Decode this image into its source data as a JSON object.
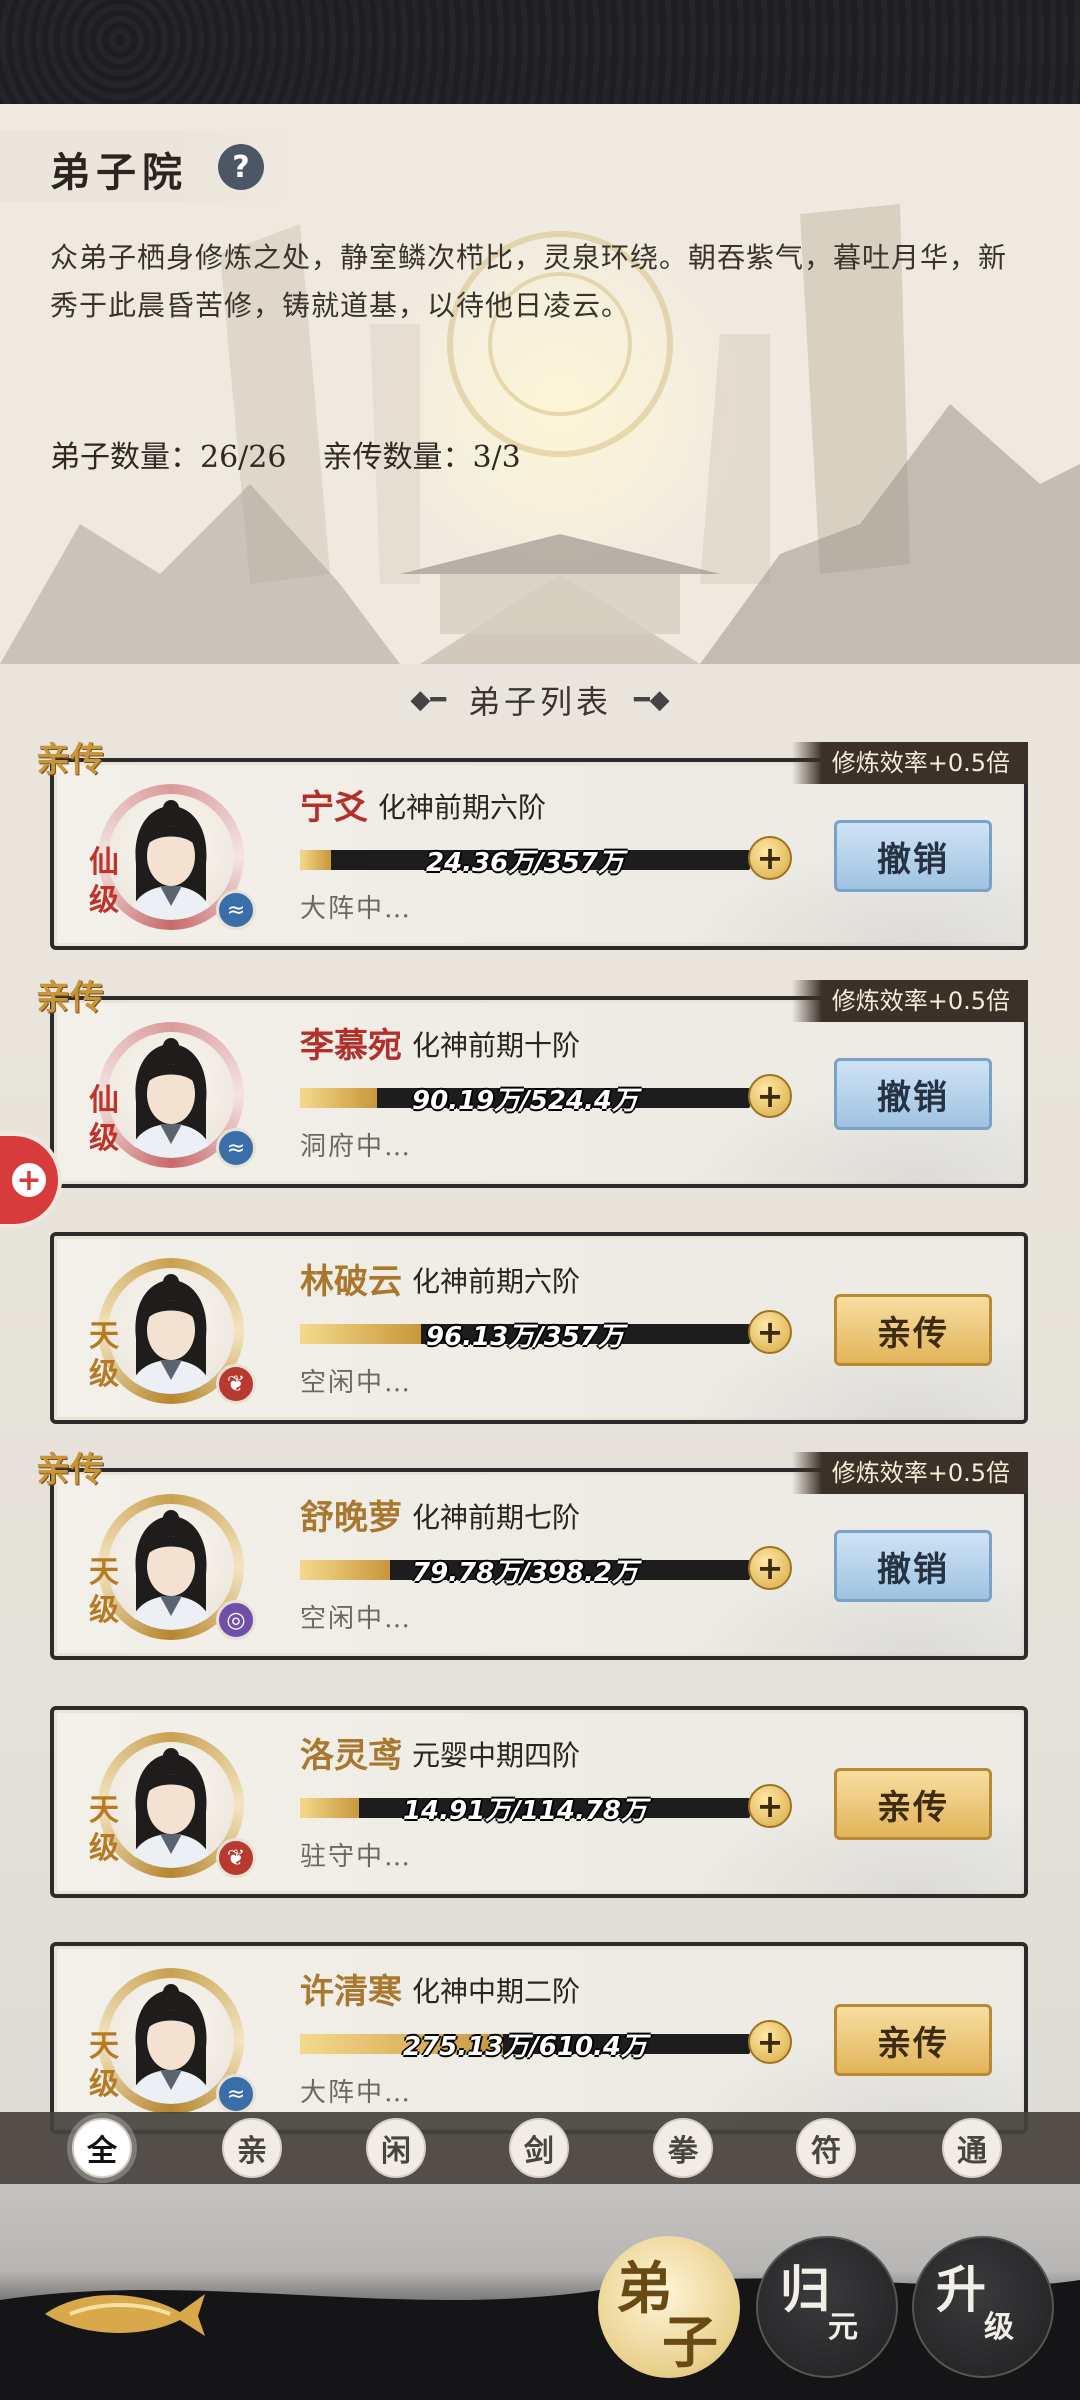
{
  "header": {
    "title": "弟子院",
    "help_icon": "?",
    "description": "众弟子栖身修炼之处，静室鳞次栉比，灵泉环绕。朝吞紫气，暮吐月华，新秀于此晨昏苦修，铸就道基，以待他日凌云。",
    "disciple_count": "弟子数量：26/26",
    "inner_count": "亲传数量：3/3"
  },
  "list_title": "弟子列表",
  "disciples": [
    {
      "tag": "亲传",
      "rate": "修炼效率+0.5倍",
      "grade": "仙级",
      "name": "宁爻",
      "realm": "化神前期六阶",
      "progress_text": "24.36万/357万",
      "progress": 0.068,
      "status": "大阵中…",
      "action": "撤销",
      "element_icon": "water-icon"
    },
    {
      "tag": "亲传",
      "rate": "修炼效率+0.5倍",
      "grade": "仙级",
      "name": "李慕宛",
      "realm": "化神前期十阶",
      "progress_text": "90.19万/524.4万",
      "progress": 0.172,
      "status": "洞府中…",
      "action": "撤销",
      "element_icon": "water-icon"
    },
    {
      "tag": "",
      "rate": "",
      "grade": "天级",
      "name": "林破云",
      "realm": "化神前期六阶",
      "progress_text": "96.13万/357万",
      "progress": 0.269,
      "status": "空闲中…",
      "action": "亲传",
      "element_icon": "fire-icon"
    },
    {
      "tag": "亲传",
      "rate": "修炼效率+0.5倍",
      "grade": "天级",
      "name": "舒晚萝",
      "realm": "化神前期七阶",
      "progress_text": "79.78万/398.2万",
      "progress": 0.2,
      "status": "空闲中…",
      "action": "撤销",
      "element_icon": "wind-icon"
    },
    {
      "tag": "",
      "rate": "",
      "grade": "天级",
      "name": "洛灵鸢",
      "realm": "元婴中期四阶",
      "progress_text": "14.91万/114.78万",
      "progress": 0.13,
      "status": "驻守中…",
      "action": "亲传",
      "element_icon": "fire-icon"
    },
    {
      "tag": "",
      "rate": "",
      "grade": "天级",
      "name": "许清寒",
      "realm": "化神中期二阶",
      "progress_text": "275.13万/610.4万",
      "progress": 0.451,
      "status": "大阵中…",
      "action": "亲传",
      "element_icon": "water-icon"
    }
  ],
  "filters": [
    "全",
    "亲",
    "闲",
    "剑",
    "拳",
    "符",
    "通"
  ],
  "nav": {
    "disciples": {
      "big": "弟",
      "small": "子"
    },
    "return": {
      "big": "归",
      "small": "元"
    },
    "upgrade": {
      "big": "升",
      "small": "级"
    }
  },
  "side_tab": "+"
}
